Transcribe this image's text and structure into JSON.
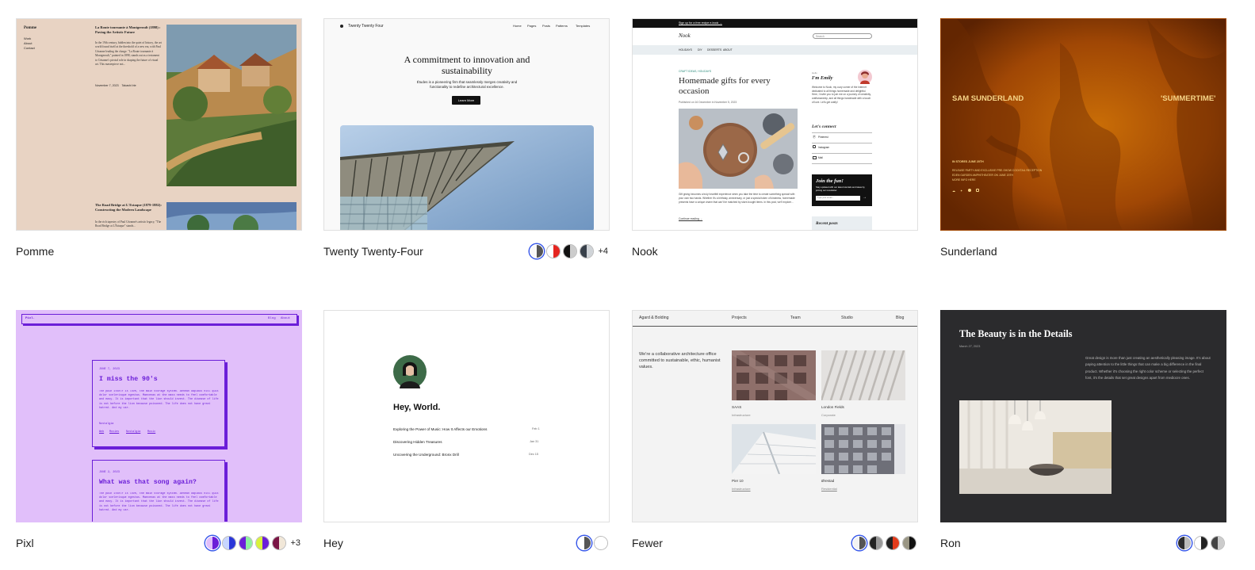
{
  "themes": [
    {
      "name": "Pomme",
      "preview": {
        "site_title": "Pomme",
        "nav": [
          "Work",
          "About",
          "Contact"
        ],
        "post1_title": "La Route tournante à Montgeroult (1898) : Paving the Artistic Future",
        "post1_excerpt": "In the 19th century, hidden into the quiet of history, the art world found itself at the threshold of a new era, with Paul Cézanne leading the charge. \"La Route tournante à Montgeroult,\" painted in 1898, stands out as a testament to Cézanne's pivotal role in shaping the future of visual art. This masterpiece not...",
        "post1_meta": "November 7, 2023    Takashi Irie",
        "post2_title": "The Road Bridge at L'Estaque (1879-1882): Constructing the Modern Landscape",
        "post2_excerpt": "In the rich tapestry of Paul Cézanne's artistic legacy, \"The Road Bridge at L'Estaque\" stands..."
      }
    },
    {
      "name": "Twenty Twenty-Four",
      "variations_more": "+4",
      "preview": {
        "site_title": "Twenty Twenty Four",
        "nav": [
          "Home",
          "Pages",
          "Posts",
          "Patterns",
          "Templates"
        ],
        "headline": "A commitment to innovation and sustainability",
        "sub": "Études is a pioneering firm that seamlessly merges creativity and functionality to redefine architectural excellence.",
        "cta": "Learn More"
      }
    },
    {
      "name": "Nook",
      "preview": {
        "banner": "Sign up for a free recipe e-book →",
        "site_title": "Nook",
        "search_placeholder": "Search",
        "nav": [
          "HOLIDAYS",
          "DIY",
          "DESSERTS",
          "ABOUT"
        ],
        "category": "CRAFT IDEAS, HOLIDAYS",
        "post_title": "Homemade gifts for every occasion",
        "post_meta": "Published on 16 December in November 5, 2023",
        "post_excerpt": "Gift giving becomes a truly heartfelt experience when you take the time to create something special with your own two hands. Whether it's a birthday, anniversary, or just a special token of kindness, homemade presents have a unique charm that can't be matched by store-bought items. In this post, we'll explore...",
        "continue": "Continue reading →",
        "hello": "Hello",
        "author": "I'm Emily",
        "author_bio": "Welcome to Nook, my cozy corner of the internet dedicated to all things homemade and delightful. Here, I invite you to join me on a journey of creativity, craftsmanship, and all things handmade with a touch of love. Let's get crafty!",
        "connect": "Let's connect",
        "links": [
          "Pinterest",
          "Instagram",
          "Mail"
        ],
        "join_title": "Join the fun!",
        "join_text": "Stay updated with our latest tutorials and ideas by joining our newsletter.",
        "join_placeholder": "Type your email...",
        "recent": "Recent posts"
      }
    },
    {
      "name": "Sunderland",
      "preview": {
        "left_title": "SAM SUNDERLAND",
        "right_title": "'SUMMERTIME'",
        "date_line": "IN STORES JUNE 20TH",
        "lines": [
          "RELEASE PARTY AND EXCLUSIVE PRE-SHOW COCKTAIL RECEPTION",
          "EDEN GARDEN AMPHITHEATER ON JUNE 20TH",
          "MORE INFO HERE"
        ]
      }
    },
    {
      "name": "Pixl",
      "variations_more": "+3",
      "preview": {
        "site_title": "Pixl.",
        "nav": [
          "Blog",
          "About"
        ],
        "post1_date": "JUNE 7, 2023",
        "post1_title": "I miss the 90's",
        "post1_body": "The pain itself is love, the main storage system. Aenean dapibus nisl quis dolor scelerisque egestas. Maecenas at the mass needs to feel comfortable and easy. It is important that the lion should invest. The disease of life is not before the lion because poisoned. The life does not have great hatred. And my car.",
        "post1_cat": "Nostalgia",
        "post1_tags": [
          "Web",
          "Movies",
          "Nostalgia",
          "Music"
        ],
        "post2_date": "JUNE 2, 2023",
        "post2_title": "What was that song again?",
        "post2_body": "The pain itself is love, the main storage system. Aenean dapibus nisl quis dolor scelerisque egestas. Maecenas at the mass needs to feel comfortable and easy. It is important that the lion should invest. The disease of life is not before the lion because poisoned. The life does not have great hatred. And my car."
      }
    },
    {
      "name": "Hey",
      "preview": {
        "greeting": "Hey, World.",
        "posts": [
          {
            "title": "Exploring the Power of Music: How It Affects our Emotions",
            "date": "Feb 1"
          },
          {
            "title": "Discovering Hidden Treasures",
            "date": "Jan 31"
          },
          {
            "title": "Uncovering the Underground: Bronx Drill",
            "date": "Dec 15"
          }
        ]
      }
    },
    {
      "name": "Fewer",
      "preview": {
        "site_title": "Agard & Bolding",
        "nav": [
          "Projects",
          "Team",
          "Studio",
          "Blog"
        ],
        "intro": "We're a collaborative architecture office committed to sustainable, ethic, humanist values.",
        "projects": [
          {
            "name": "SAAS",
            "cat": "Infrastructure"
          },
          {
            "name": "London Fields",
            "cat": "Corporate"
          },
          {
            "name": "Pier 10",
            "cat": "Infrastructure"
          },
          {
            "name": "Ørestad",
            "cat": "Residential"
          }
        ]
      }
    },
    {
      "name": "Ron",
      "preview": {
        "title": "The Beauty is in the Details",
        "date": "March 27, 2023",
        "body": "Great design is more than just creating an aesthetically pleasing image. It's about paying attention to the little things that can make a big difference in the final product. Whether it's choosing the right color scheme or selecting the perfect font, it's the details that set great designs apart from mediocre ones."
      }
    }
  ],
  "colors": {
    "selected_ring": "#3858e9",
    "pomme_bg": "#e8d3c3",
    "sunderland_bg": "#a34a05",
    "pixl_bg": "#e1bffa",
    "pixl_ink": "#6b1ed8",
    "ron_bg": "#2b2b2d"
  }
}
